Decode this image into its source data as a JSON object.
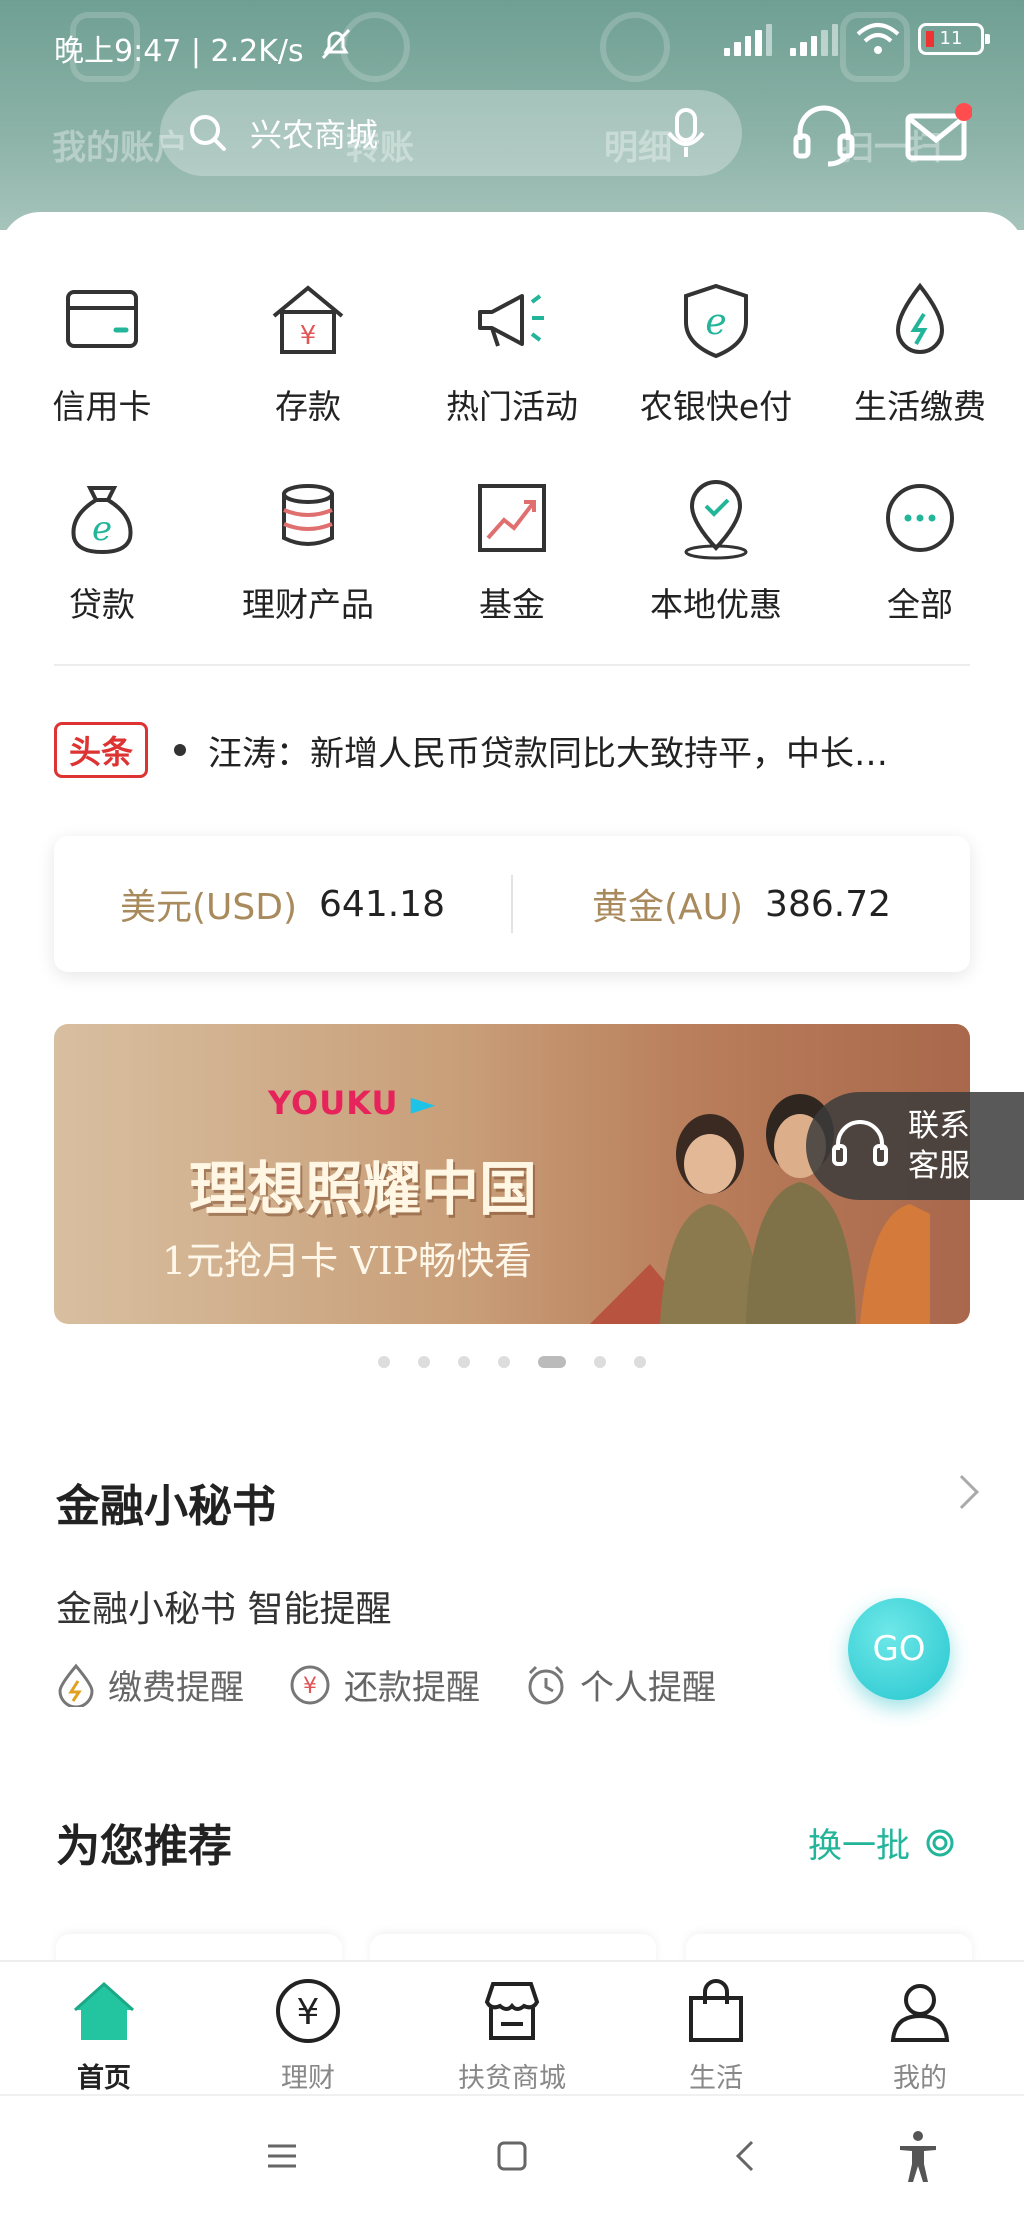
{
  "status_bar": {
    "time": "晚上9:47 | 2.2K/s",
    "battery": "11"
  },
  "header": {
    "search_placeholder": "兴农商城",
    "ghost_labels": [
      "我的账户",
      "转账",
      "明细",
      "扫一扫"
    ]
  },
  "services": [
    {
      "label": "信用卡",
      "icon": "credit-card-icon"
    },
    {
      "label": "存款",
      "icon": "deposit-house-icon"
    },
    {
      "label": "热门活动",
      "icon": "megaphone-icon"
    },
    {
      "label": "农银快e付",
      "icon": "shield-e-icon"
    },
    {
      "label": "生活缴费",
      "icon": "water-drop-icon"
    },
    {
      "label": "贷款",
      "icon": "money-bag-icon"
    },
    {
      "label": "理财产品",
      "icon": "coin-stack-icon"
    },
    {
      "label": "基金",
      "icon": "trend-chart-icon"
    },
    {
      "label": "本地优惠",
      "icon": "location-pin-icon"
    },
    {
      "label": "全部",
      "icon": "more-icon"
    }
  ],
  "news": {
    "tag": "头条",
    "text": "汪涛：新增人民币贷款同比大致持平，中长…"
  },
  "rates": [
    {
      "name": "美元(USD)",
      "value": "641.18"
    },
    {
      "name": "黄金(AU)",
      "value": "386.72"
    }
  ],
  "banner": {
    "brand": "YOUKU",
    "title": "理想照耀中国",
    "subtitle": "1元抢月卡 VIP畅快看",
    "active_index": 4,
    "count": 7
  },
  "float_service": {
    "label": "联系客服"
  },
  "secretary": {
    "title": "金融小秘书",
    "subtitle": "金融小秘书 智能提醒",
    "go_label": "GO",
    "reminders": [
      "缴费提醒",
      "还款提醒",
      "个人提醒"
    ]
  },
  "recommend": {
    "title": "为您推荐",
    "refresh_label": "换一批"
  },
  "tabs": [
    {
      "label": "首页",
      "active": true
    },
    {
      "label": "理财",
      "active": false
    },
    {
      "label": "扶贫商城",
      "active": false
    },
    {
      "label": "生活",
      "active": false
    },
    {
      "label": "我的",
      "active": false
    }
  ],
  "colors": {
    "accent": "#22b59a",
    "header": "#8db3a8",
    "news_tag": "#dd3333",
    "rate_name": "#a88a5c"
  }
}
